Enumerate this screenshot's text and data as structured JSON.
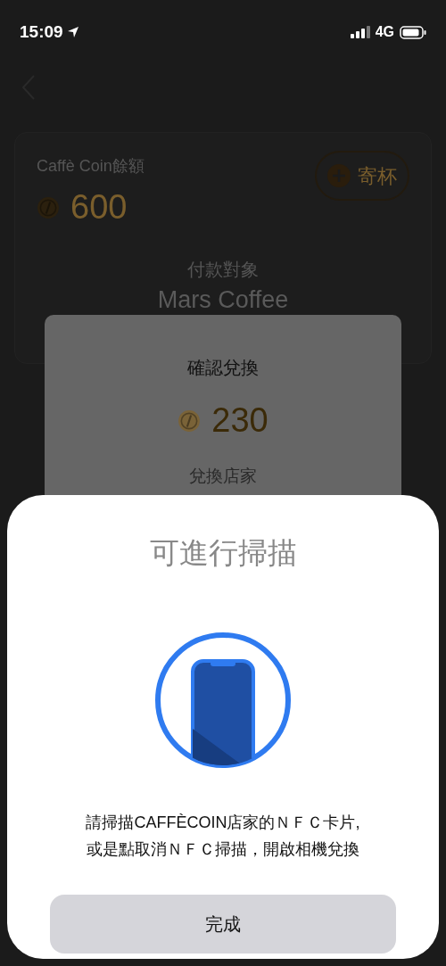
{
  "status_bar": {
    "time": "15:09",
    "network": "4G"
  },
  "balance_card": {
    "label": "Caffè Coin餘額",
    "amount": "600",
    "deposit_button": "寄杯"
  },
  "payee": {
    "label": "付款對象",
    "name": "Mars Coffee"
  },
  "confirm_dialog": {
    "title": "確認兌換",
    "amount": "230",
    "store_label": "兌換店家"
  },
  "nfc_sheet": {
    "title": "可進行掃描",
    "instruction_lines": [
      "請掃描CAFFÈCOIN店家的ＮＦＣ卡片,",
      "或是點取消ＮＦＣ掃描，開啟相機兌換"
    ],
    "done_button": "完成"
  }
}
